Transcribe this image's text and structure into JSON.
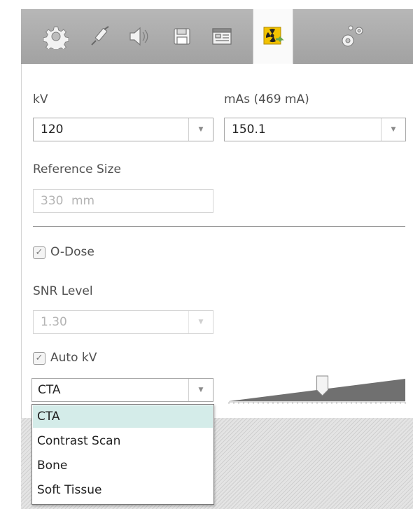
{
  "toolbar": {
    "icons": [
      "gear-icon",
      "syringe-icon",
      "speaker-icon",
      "save-icon",
      "report-icon",
      "radiation-dose-icon",
      "settings-gears-icon"
    ],
    "active_index": 5,
    "colors": {
      "radiation_yellow": "#f2c200",
      "accent_green": "#6aa64a"
    }
  },
  "kv": {
    "label": "kV",
    "value": "120"
  },
  "mas": {
    "label": "mAs (469 mA)",
    "value": "150.1"
  },
  "reference_size": {
    "label": "Reference Size",
    "value": "330",
    "unit": "mm"
  },
  "o_dose": {
    "label": "O-Dose",
    "checked": true
  },
  "snr": {
    "label": "SNR Level",
    "value": "1.30"
  },
  "auto_kv": {
    "label": "Auto kV",
    "checked": true
  },
  "protocol": {
    "value": "CTA",
    "options": [
      "CTA",
      "Contrast Scan",
      "Bone",
      "Soft Tissue"
    ],
    "selected_index": 0
  },
  "slider": {
    "position_fraction": 0.53
  }
}
